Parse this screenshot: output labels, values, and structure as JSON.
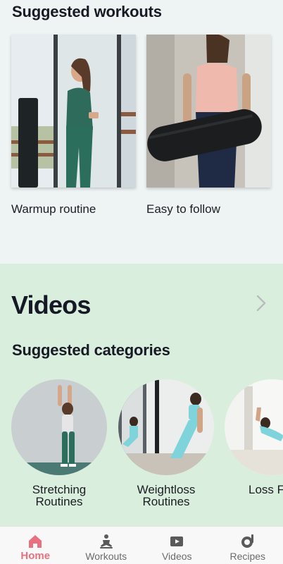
{
  "suggested_workouts": {
    "title": "Suggested workouts",
    "cards": [
      {
        "caption": "Warmup routine",
        "image": "woman-with-phone-photo"
      },
      {
        "caption": "Easy to follow",
        "image": "woman-holding-yoga-mat-photo"
      }
    ]
  },
  "videos": {
    "title": "Videos",
    "more_icon": "chevron-right-icon",
    "categories_title": "Suggested categories",
    "categories": [
      {
        "line1": "Stretching",
        "line2": "Routines",
        "image": "wall-stretch-photo"
      },
      {
        "line1": "Weightloss",
        "line2": "Routines",
        "image": "mirror-workout-photo"
      },
      {
        "line1": "Loss F",
        "line2": "",
        "image": "floor-stretch-photo"
      }
    ]
  },
  "tabbar": {
    "active_color": "#e9707f",
    "tabs": [
      {
        "label": "Home",
        "icon": "home-icon",
        "active": true
      },
      {
        "label": "Workouts",
        "icon": "meditation-icon",
        "active": false
      },
      {
        "label": "Videos",
        "icon": "video-icon",
        "active": false
      },
      {
        "label": "Recipes",
        "icon": "recipes-icon",
        "active": false
      }
    ]
  }
}
